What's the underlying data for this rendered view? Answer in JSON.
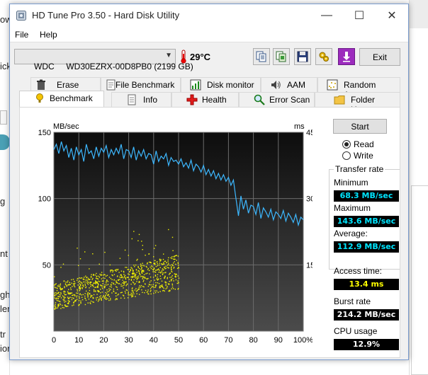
{
  "background": {
    "fragments": [
      "ow",
      "ick",
      "g",
      "nt",
      "ght",
      "ler",
      "tr",
      "ior"
    ]
  },
  "window": {
    "title": "HD Tune Pro 3.50 - Hard Disk Utility",
    "controls": {
      "minimize": "—",
      "maximize": "☐",
      "close": "✕"
    }
  },
  "menu": {
    "file": "File",
    "help": "Help"
  },
  "toolbar": {
    "drive": "WDC     WD30EZRX-00D8PB0 (2199 GB)",
    "temperature": "29°C",
    "exit_label": "Exit",
    "icons": [
      "copy-text-icon",
      "copy-screenshot-icon",
      "save-icon",
      "options-icon",
      "download-icon"
    ]
  },
  "tabs": {
    "row1": [
      {
        "label": "Erase",
        "icon": "erase-icon"
      },
      {
        "label": "File Benchmark",
        "icon": "file-benchmark-icon"
      },
      {
        "label": "Disk monitor",
        "icon": "disk-monitor-icon"
      },
      {
        "label": "AAM",
        "icon": "speaker-icon"
      },
      {
        "label": "Random Access",
        "icon": "random-access-icon"
      }
    ],
    "row2": [
      {
        "label": "Benchmark",
        "icon": "benchmark-icon",
        "active": true
      },
      {
        "label": "Info",
        "icon": "info-icon"
      },
      {
        "label": "Health",
        "icon": "health-cross-icon"
      },
      {
        "label": "Error Scan",
        "icon": "magnifier-icon"
      },
      {
        "label": "Folder Usage",
        "icon": "folder-icon"
      }
    ]
  },
  "controls": {
    "start_label": "Start",
    "read_label": "Read",
    "write_label": "Write",
    "mode": "Read"
  },
  "results": {
    "transfer_rate_title": "Transfer rate",
    "minimum_label": "Minimum",
    "minimum_value": "68.3 MB/sec",
    "maximum_label": "Maximum",
    "maximum_value": "143.6 MB/sec",
    "average_label": "Average:",
    "average_value": "112.9 MB/sec",
    "access_time_label": "Access time:",
    "access_time_value": "13.4 ms",
    "burst_rate_label": "Burst rate",
    "burst_rate_value": "214.2 MB/sec",
    "cpu_usage_label": "CPU usage",
    "cpu_usage_value": "12.9%"
  },
  "colors": {
    "transfer_line": "#3db8ff",
    "access_points": "#f2f200",
    "chart_bg_top": "#111111",
    "chart_bg_bottom": "#4a4a4a",
    "value_box_bg": "#000000"
  },
  "chart_data": {
    "type": "line",
    "y_left_label": "MB/sec",
    "y_right_label": "ms",
    "x_ticks": [
      "0",
      "10",
      "20",
      "30",
      "40",
      "50",
      "60",
      "70",
      "80",
      "90",
      "100%"
    ],
    "y_left_ticks": [
      "150",
      "100",
      "50"
    ],
    "y_right_ticks": [
      "45",
      "30",
      "15"
    ],
    "xlim": [
      0,
      100
    ],
    "ylim_left": [
      0,
      150
    ],
    "ylim_right": [
      0,
      45
    ],
    "grid": true,
    "series": [
      {
        "kind": "transfer-rate",
        "x": [
          0,
          1,
          2,
          3,
          4,
          5,
          6,
          7,
          8,
          9,
          10,
          11,
          12,
          13,
          14,
          15,
          16,
          17,
          18,
          19,
          20,
          21,
          22,
          23,
          24,
          25,
          26,
          27,
          28,
          29,
          30,
          31,
          32,
          33,
          34,
          35,
          36,
          37,
          38,
          39,
          40,
          41,
          42,
          43,
          44,
          45,
          46,
          47,
          48,
          49,
          50,
          51,
          52,
          53,
          54,
          55,
          56,
          57,
          58,
          59,
          60,
          61,
          62,
          63,
          64,
          65,
          66,
          67,
          68,
          69,
          70,
          71,
          72,
          73,
          74,
          75,
          76,
          77,
          78,
          79,
          80,
          81,
          82,
          83,
          84,
          85,
          86,
          87,
          88,
          89,
          90,
          91,
          92,
          93,
          94,
          95,
          96,
          97,
          98,
          99,
          100
        ],
        "y": [
          137,
          141,
          134,
          143,
          136,
          140,
          131,
          138,
          129,
          139,
          133,
          137,
          128,
          141,
          134,
          136,
          130,
          139,
          132,
          138,
          135,
          140,
          131,
          137,
          133,
          138,
          134,
          141,
          130,
          137,
          136,
          131,
          139,
          129,
          136,
          132,
          137,
          130,
          134,
          133,
          126,
          136,
          128,
          132,
          130,
          134,
          125,
          131,
          128,
          129,
          126,
          130,
          124,
          127,
          123,
          129,
          121,
          126,
          124,
          120,
          125,
          118,
          122,
          117,
          121,
          115,
          119,
          114,
          118,
          113,
          116,
          110,
          114,
          100,
          87,
          102,
          92,
          99,
          89,
          95,
          94,
          88,
          97,
          85,
          93,
          90,
          86,
          92,
          84,
          90,
          88,
          85,
          91,
          83,
          89,
          86,
          82,
          88,
          80,
          86,
          84
        ]
      },
      {
        "kind": "access-time",
        "note": "scatter of access times in ms, right axis"
      }
    ]
  }
}
